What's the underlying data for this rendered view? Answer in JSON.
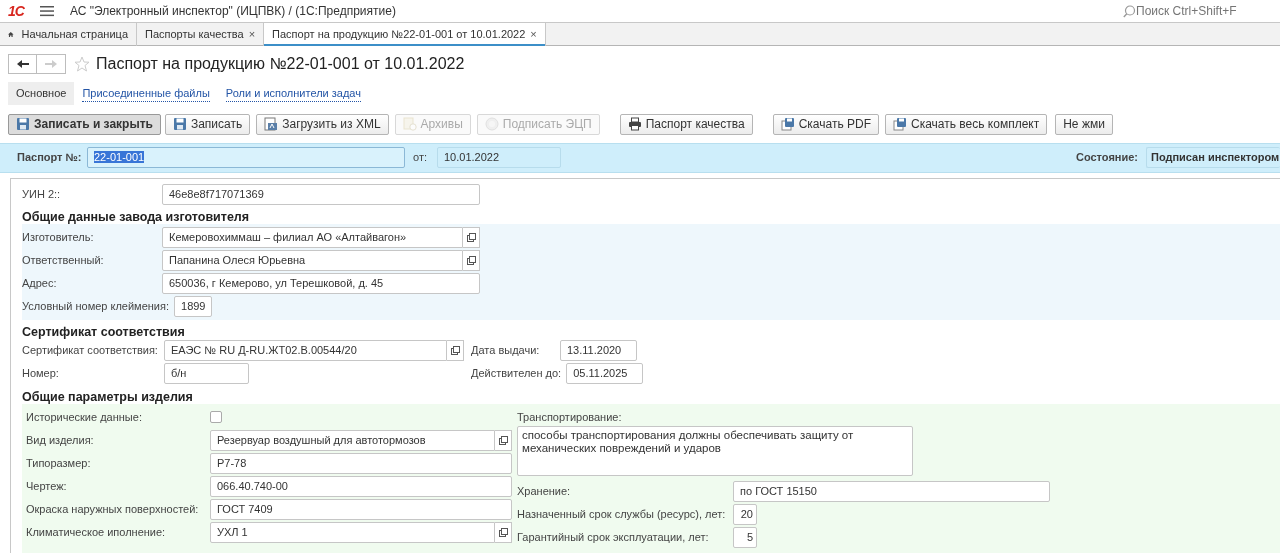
{
  "app_bar": {
    "logo": "1С",
    "title": "АС \"Электронный инспектор\" (ИЦПВК) /  (1С:Предприятие)",
    "search": {
      "placeholder": "Поиск Ctrl+Shift+F"
    }
  },
  "tabs": [
    {
      "label": "Начальная страница",
      "kind": "home",
      "selected": false
    },
    {
      "label": "Паспорты качества",
      "close": "×",
      "selected": false
    },
    {
      "label": "Паспорт на продукцию №22-01-001 от 10.01.2022",
      "close": "×",
      "selected": true
    }
  ],
  "form": {
    "title": "Паспорт на продукцию №22-01-001 от 10.01.2022",
    "favorite": false,
    "nav": [
      {
        "kind": "back",
        "disabled": false
      },
      {
        "kind": "forward",
        "disabled": true
      }
    ],
    "pages": [
      {
        "label": "Основное",
        "selected": true
      },
      {
        "label": "Присоединенные файлы",
        "selected": false
      },
      {
        "label": "Роли и исполнители задач",
        "selected": false
      }
    ],
    "toolbar": [
      {
        "label": "Записать и закрыть",
        "kind": "save",
        "default": true,
        "disabled": false
      },
      {
        "label": "Записать",
        "kind": "save",
        "default": false,
        "disabled": false
      },
      {
        "label": "Загрузить из XML",
        "kind": "import",
        "default": false,
        "disabled": false
      },
      {
        "label": "Архивы",
        "kind": "archive",
        "default": false,
        "disabled": true
      },
      {
        "label": "Подписать ЭЦП",
        "kind": "sign",
        "default": false,
        "disabled": true
      },
      {
        "label": "Паспорт качества",
        "kind": "print",
        "default": false,
        "disabled": false
      },
      {
        "label": "Скачать  PDF",
        "kind": "download",
        "default": false,
        "disabled": false
      },
      {
        "label": "Скачать весь комплект",
        "kind": "download",
        "default": false,
        "disabled": false
      },
      {
        "label": "Не жми",
        "kind": "none",
        "default": false,
        "disabled": false
      }
    ],
    "header": {
      "number": {
        "label": "Паспорт №:",
        "value": "22-01-001",
        "text_selected": true
      },
      "date": {
        "label": "от:",
        "value": "10.01.2022"
      },
      "state": {
        "label": "Состояние:",
        "value": "Подписан инспектором"
      }
    },
    "sections": [
      {
        "rows": [
          {
            "label": "УИН 2::",
            "value": "46e8e8f717071369",
            "kind": "text"
          }
        ]
      },
      {
        "heading": "Общие данные завода изготовителя",
        "rows": [
          {
            "label": "Изготовитель:",
            "value": "Кемеровохиммаш – филиал АО «Алтайвагон»",
            "kind": "lookup"
          },
          {
            "label": "Ответственный:",
            "value": "Папанина Олеся Юрьевна",
            "kind": "lookup"
          },
          {
            "label": "Адрес:",
            "value": "650036, г Кемерово, ул Терешковой, д. 45",
            "kind": "text"
          },
          {
            "label": "Условный номер клеймения:",
            "value": "1899",
            "kind": "text"
          }
        ]
      },
      {
        "heading": "Сертификат соответствия",
        "rows": [
          {
            "label": "Сертификат соответствия:",
            "value": "ЕАЭС № RU Д-RU.ЖТ02.В.00544/20",
            "kind": "lookup"
          },
          {
            "label": "Номер:",
            "value": "б/н",
            "kind": "text"
          }
        ],
        "side_rows": [
          {
            "label": "Дата выдачи:",
            "value": "13.11.2020",
            "kind": "text"
          },
          {
            "label": "Действителен до:",
            "value": "05.11.2025",
            "kind": "text"
          }
        ]
      },
      {
        "heading": "Общие параметры изделия",
        "rows": [
          {
            "label": "Исторические данные:",
            "checked": false,
            "kind": "checkbox"
          },
          {
            "label": "Вид изделия:",
            "value": "Резервуар воздушный для автотормозов",
            "kind": "lookup"
          },
          {
            "label": "Типоразмер:",
            "value": "Р7-78",
            "kind": "text"
          },
          {
            "label": "Чертеж:",
            "value": "066.40.740-00",
            "kind": "text"
          },
          {
            "label": "Окраска наружных поверхностей:",
            "value": "ГОСТ 7409",
            "kind": "text"
          },
          {
            "label": "Климатическое иполнение:",
            "value": "УХЛ 1",
            "kind": "lookup"
          }
        ],
        "side_rows": [
          {
            "label": "Транспортирование:",
            "value": "способы транспортирования должны обеспечивать защиту от механических повреждений и ударов",
            "kind": "textarea"
          },
          {
            "label": "Хранение:",
            "value": "по ГОСТ 15150",
            "kind": "text"
          },
          {
            "label": "Назначенный срок службы (ресурс), лет:",
            "value": "20",
            "kind": "number"
          },
          {
            "label": "Гарантийный срок эксплуатации, лет:",
            "value": "5",
            "kind": "number"
          }
        ]
      }
    ]
  }
}
